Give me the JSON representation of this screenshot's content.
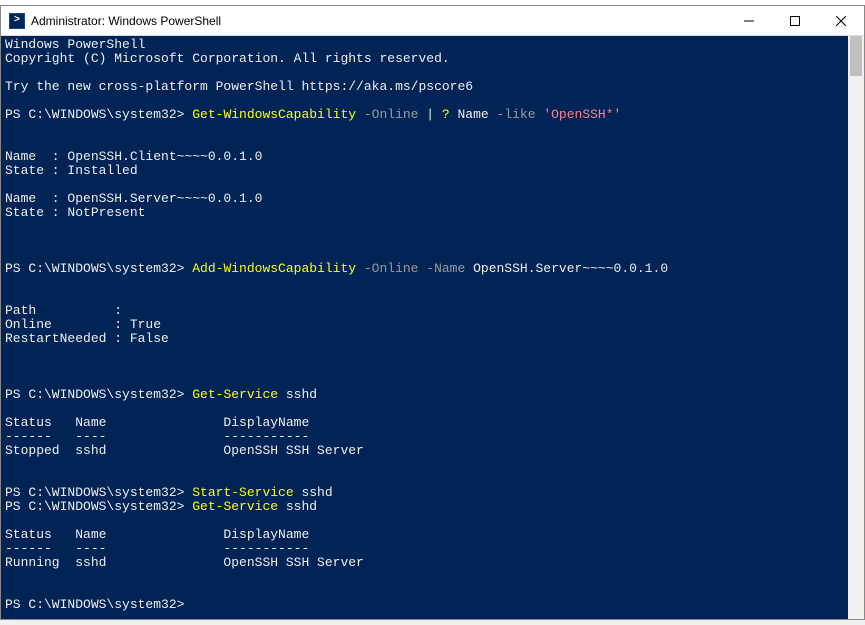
{
  "title": "Administrator: Windows PowerShell",
  "colors": {
    "terminal_bg": "#012456",
    "text": "#cccccc",
    "cmd": "#ffff00",
    "param": "#9a9a9a",
    "string": "#ff7f8c"
  },
  "banner": {
    "l1": "Windows PowerShell",
    "l2": "Copyright (C) Microsoft Corporation. All rights reserved.",
    "l3": "Try the new cross-platform PowerShell https://aka.ms/pscore6"
  },
  "prompt": "PS C:\\WINDOWS\\system32> ",
  "cmd1": {
    "c1": "Get-WindowsCapability",
    "p1": " -Online ",
    "pipe": "| ",
    "c2": "? ",
    "arg": "Name ",
    "p2": "-like ",
    "str": "'OpenSSH*'"
  },
  "out1": {
    "e1_name": "Name  : OpenSSH.Client~~~~0.0.1.0",
    "e1_state": "State : Installed",
    "e2_name": "Name  : OpenSSH.Server~~~~0.0.1.0",
    "e2_state": "State : NotPresent"
  },
  "cmd2": {
    "c1": "Add-WindowsCapability",
    "p1": " -Online -Name ",
    "arg": "OpenSSH.Server~~~~0.0.1.0"
  },
  "out2": {
    "l1": "Path          :",
    "l2": "Online        : True",
    "l3": "RestartNeeded : False"
  },
  "cmd3": {
    "c1": "Get-Service ",
    "arg": "sshd"
  },
  "tbl1": {
    "hdr": "Status   Name               DisplayName",
    "sep": "------   ----               -----------",
    "row": "Stopped  sshd               OpenSSH SSH Server"
  },
  "cmd4": {
    "c1": "Start-Service ",
    "arg": "sshd"
  },
  "cmd5": {
    "c1": "Get-Service ",
    "arg": "sshd"
  },
  "tbl2": {
    "hdr": "Status   Name               DisplayName",
    "sep": "------   ----               -----------",
    "row": "Running  sshd               OpenSSH SSH Server"
  }
}
